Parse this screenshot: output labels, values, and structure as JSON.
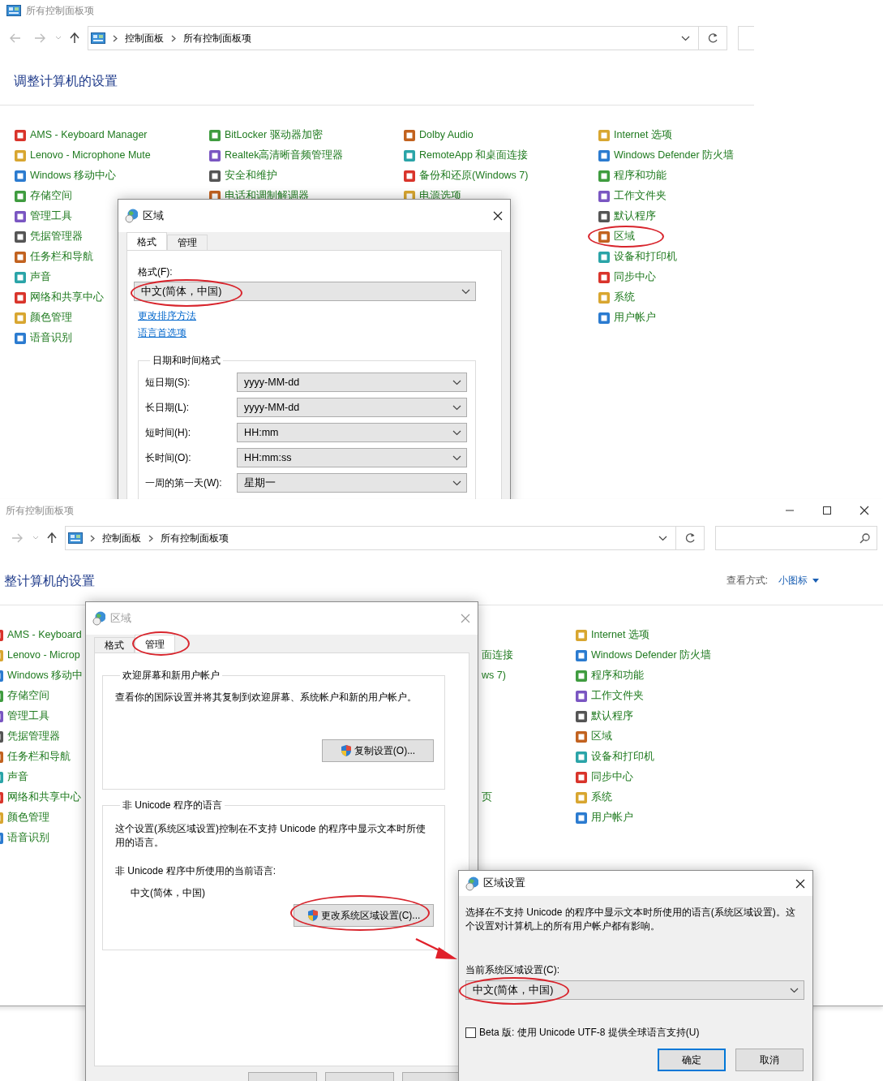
{
  "windows": [
    {
      "title": "所有控制面板项",
      "breadcrumb": [
        "控制面板",
        "所有控制面板项"
      ],
      "heading": "调整计算机的设置",
      "columns": {
        "column_1": [
          {
            "label": "AMS - Keyboard Manager",
            "circled": false
          },
          {
            "label": "Lenovo - Microphone Mute",
            "circled": false
          },
          {
            "label": "Windows 移动中心",
            "circled": false
          },
          {
            "label": "存储空间",
            "circled": false
          },
          {
            "label": "管理工具",
            "circled": false
          },
          {
            "label": "凭据管理器",
            "circled": false
          },
          {
            "label": "任务栏和导航",
            "circled": false
          },
          {
            "label": "声音",
            "circled": false
          },
          {
            "label": "网络和共享中心",
            "circled": false
          },
          {
            "label": "颜色管理",
            "circled": false
          },
          {
            "label": "语音识别",
            "circled": false
          }
        ],
        "column_2": [
          {
            "label": "BitLocker 驱动器加密",
            "circled": false
          },
          {
            "label": "Realtek高清晰音频管理器",
            "circled": false
          },
          {
            "label": "安全和维护",
            "circled": false
          },
          {
            "label": "电话和调制解调器",
            "circled": false
          }
        ],
        "column_3": [
          {
            "label": "Dolby Audio",
            "circled": false
          },
          {
            "label": "RemoteApp 和桌面连接",
            "circled": false
          },
          {
            "label": "备份和还原(Windows 7)",
            "circled": false
          },
          {
            "label": "电源选项",
            "circled": false
          }
        ],
        "column_4": [
          {
            "label": "Internet 选项",
            "circled": false
          },
          {
            "label": "Windows Defender 防火墙",
            "circled": false
          },
          {
            "label": "程序和功能",
            "circled": false
          },
          {
            "label": "工作文件夹",
            "circled": false
          },
          {
            "label": "默认程序",
            "circled": false
          },
          {
            "label": "区域",
            "circled": true
          },
          {
            "label": "设备和打印机",
            "circled": false
          },
          {
            "label": "同步中心",
            "circled": false
          },
          {
            "label": "系统",
            "circled": false
          },
          {
            "label": "用户帐户",
            "circled": false
          }
        ]
      },
      "dialog": {
        "kind": "format",
        "title": "区域",
        "active": true,
        "tabs": [
          {
            "label": "格式",
            "selected": true,
            "circled": false
          },
          {
            "label": "管理",
            "selected": false,
            "circled": false
          }
        ],
        "format": {
          "label": "格式(F):",
          "value": "中文(简体，中国)",
          "circled": true
        },
        "links": [
          "更改排序方法",
          "语言首选项"
        ],
        "group": {
          "title": "日期和时间格式",
          "rows": [
            {
              "label": "短日期(S):",
              "value": "yyyy-MM-dd"
            },
            {
              "label": "长日期(L):",
              "value": "yyyy-MM-dd"
            },
            {
              "label": "短时间(H):",
              "value": "HH:mm"
            },
            {
              "label": "长时间(O):",
              "value": "HH:mm:ss"
            },
            {
              "label": "一周的第一天(W):",
              "value": "星期一"
            }
          ]
        }
      }
    },
    {
      "title": "所有控制面板项",
      "breadcrumb": [
        "控制面板",
        "所有控制面板项"
      ],
      "heading": "整计算机的设置",
      "view_label": "查看方式:",
      "view_value": "小图标",
      "columns": {
        "column_1": [
          {
            "label": "AMS - Keyboard",
            "circled": false
          },
          {
            "label": "Lenovo - Microp",
            "circled": false
          },
          {
            "label": "Windows 移动中",
            "circled": false
          },
          {
            "label": "存储空间",
            "circled": false
          },
          {
            "label": "管理工具",
            "circled": false
          },
          {
            "label": "凭据管理器",
            "circled": false
          },
          {
            "label": "任务栏和导航",
            "circled": false
          },
          {
            "label": "声音",
            "circled": false
          },
          {
            "label": "网络和共享中心",
            "circled": false
          },
          {
            "label": "颜色管理",
            "circled": false
          },
          {
            "label": "语音识别",
            "circled": false
          }
        ],
        "column_3": [
          {
            "label": "面连接",
            "circled": false
          },
          {
            "label": "ws 7)",
            "circled": false
          },
          {
            "label": "页",
            "circled": false
          }
        ],
        "column_4": [
          {
            "label": "Internet 选项",
            "circled": false
          },
          {
            "label": "Windows Defender 防火墙",
            "circled": false
          },
          {
            "label": "程序和功能",
            "circled": false
          },
          {
            "label": "工作文件夹",
            "circled": false
          },
          {
            "label": "默认程序",
            "circled": false
          },
          {
            "label": "区域",
            "circled": false
          },
          {
            "label": "设备和打印机",
            "circled": false
          },
          {
            "label": "同步中心",
            "circled": false
          },
          {
            "label": "系统",
            "circled": false
          },
          {
            "label": "用户帐户",
            "circled": false
          }
        ]
      },
      "dialog": {
        "kind": "admin",
        "title": "区域",
        "active": false,
        "tabs": [
          {
            "label": "格式",
            "selected": false,
            "circled": false
          },
          {
            "label": "管理",
            "selected": true,
            "circled": true
          }
        ],
        "groups": [
          {
            "title": "欢迎屏幕和新用户帐户",
            "text": "查看你的国际设置并将其复制到欢迎屏幕、系统帐户和新的用户帐户。",
            "button": {
              "label": "复制设置(O)...",
              "circled": false
            }
          },
          {
            "title": "非 Unicode 程序的语言",
            "text": "这个设置(系统区域设置)控制在不支持 Unicode 的程序中显示文本时所使用的语言。",
            "current_label": "非 Unicode 程序中所使用的当前语言:",
            "current_value": "中文(简体，中国)",
            "button": {
              "label": "更改系统区域设置(C)...",
              "circled": true
            }
          }
        ]
      }
    }
  ],
  "region_dialog": {
    "title": "区域设置",
    "text": "选择在不支持 Unicode 的程序中显示文本时所使用的语言(系统区域设置)。这个设置对计算机上的所有用户帐户都有影响。",
    "locale_label": "当前系统区域设置(C):",
    "locale": {
      "value": "中文(简体，中国)",
      "circled": true
    },
    "beta": {
      "label": "Beta 版: 使用 Unicode UTF-8 提供全球语言支持(U)",
      "checked": false
    },
    "buttons": [
      {
        "label": "确定",
        "default": true
      },
      {
        "label": "取消",
        "default": false
      }
    ]
  },
  "annotation_arrow": true
}
